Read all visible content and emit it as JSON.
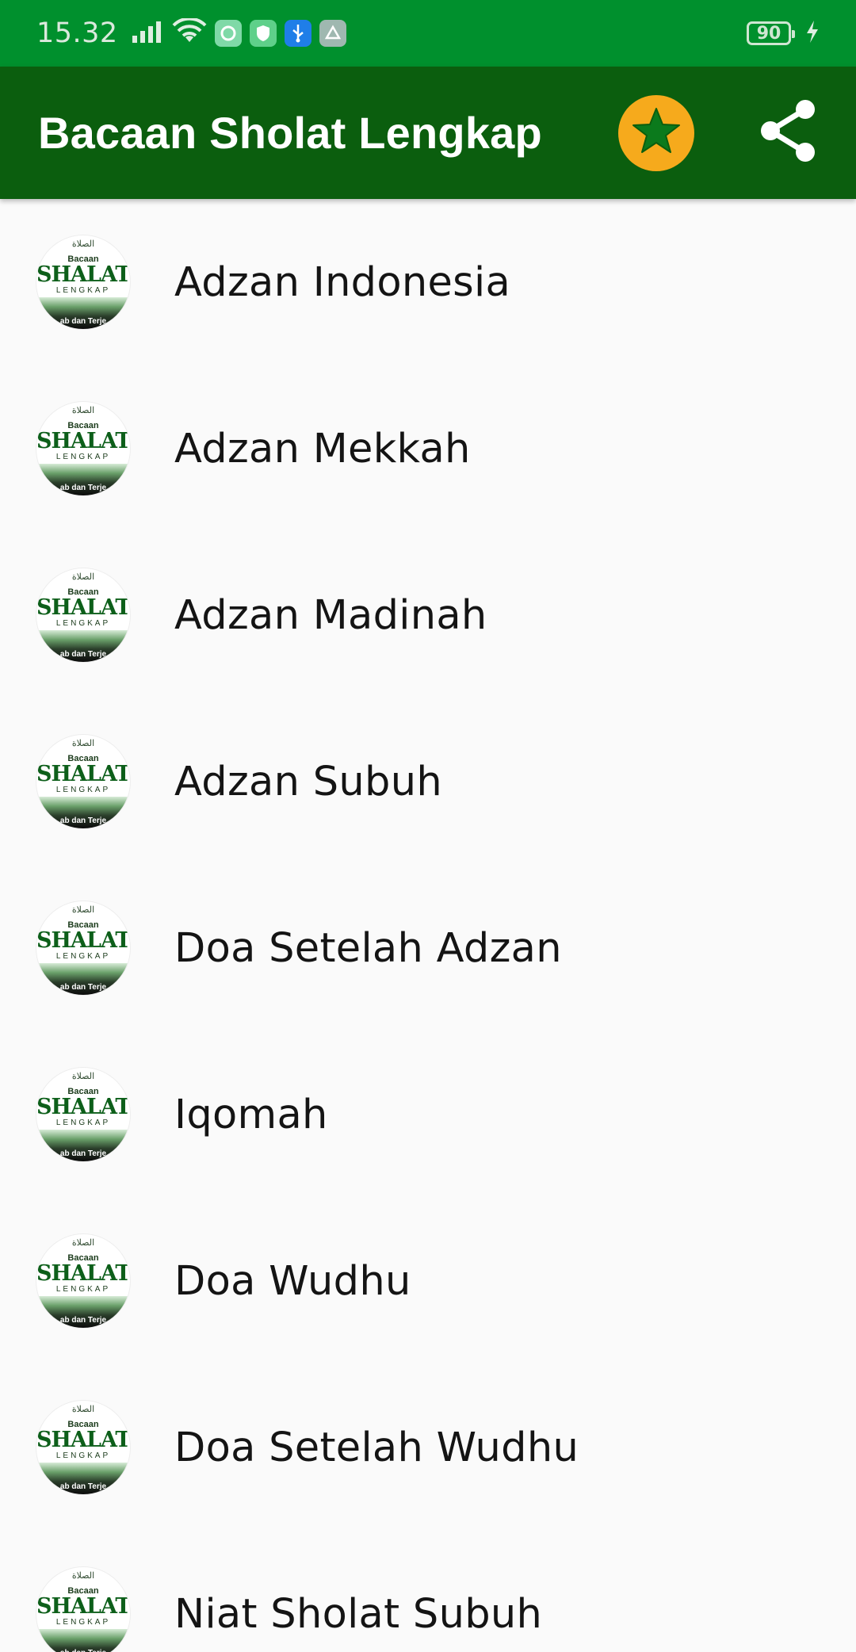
{
  "status_bar": {
    "time": "15.32",
    "battery": "90",
    "icons": [
      "signal-icon",
      "wifi-icon",
      "app-notification-icon",
      "shield-icon",
      "usb-icon",
      "photos-icon",
      "charging-icon"
    ]
  },
  "app_bar": {
    "title": "Bacaan Sholat Lengkap",
    "color": "#0b5e0e",
    "actions": [
      "star-icon",
      "share-icon"
    ]
  },
  "thumbnail": {
    "arabic": "الصلاة",
    "small": "Bacaan",
    "big": "SHALAT",
    "sub": "LENGKAP",
    "photo_text": "ab dan Terje"
  },
  "list": {
    "items": [
      "Adzan Indonesia",
      "Adzan Mekkah",
      "Adzan Madinah",
      "Adzan Subuh",
      "Doa Setelah Adzan",
      "Iqomah",
      "Doa Wudhu",
      "Doa Setelah Wudhu",
      "Niat Sholat Subuh"
    ]
  }
}
